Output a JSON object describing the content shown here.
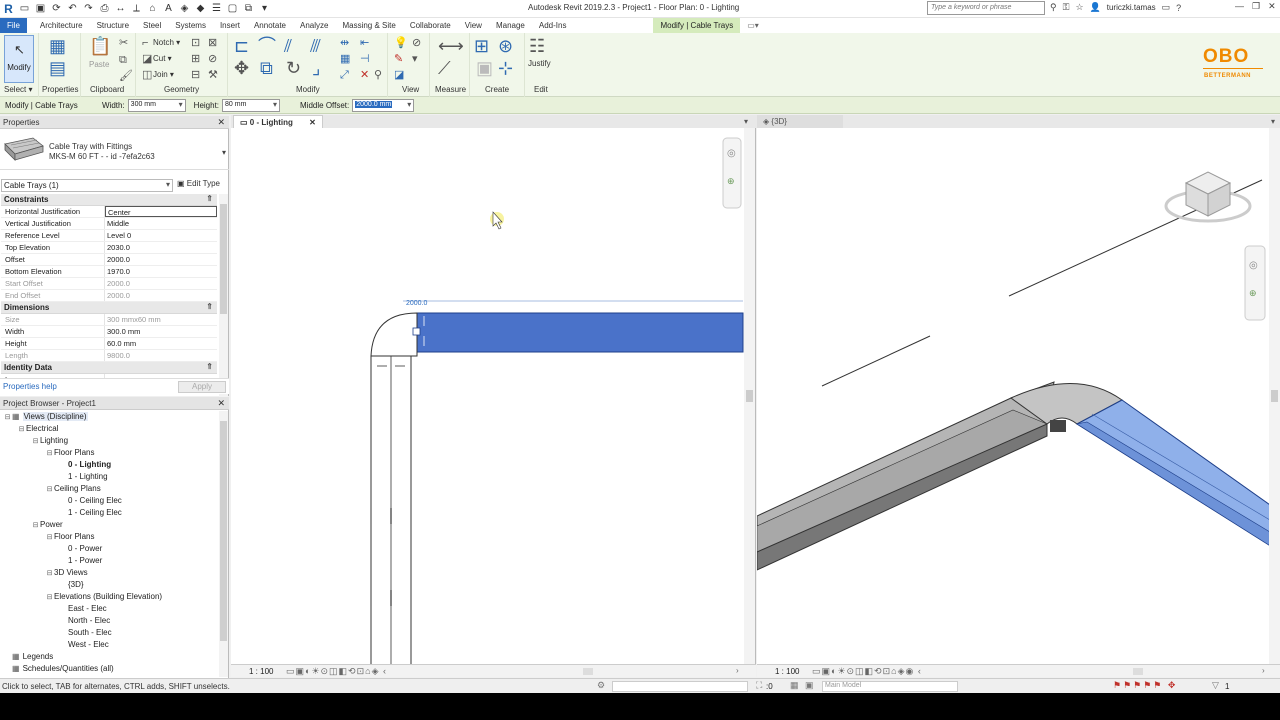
{
  "window": {
    "title": "Autodesk Revit 2019.2.3 - Project1 - Floor Plan: 0 - Lighting",
    "search_placeholder": "Type a keyword or phrase",
    "user": "turiczki.tamas"
  },
  "tabs": [
    "File",
    "Architecture",
    "Structure",
    "Steel",
    "Systems",
    "Insert",
    "Annotate",
    "Analyze",
    "Massing & Site",
    "Collaborate",
    "View",
    "Manage",
    "Add-Ins"
  ],
  "contextual_tab": "Modify | Cable Trays",
  "ribbon": {
    "modify_label": "Modify",
    "properties_label": "Properties",
    "paste_label": "Paste",
    "notch_label": "Notch",
    "cut_label": "Cut",
    "join_label": "Join",
    "justify_label": "Justify",
    "groups": {
      "select": "Select",
      "properties": "Properties",
      "clipboard": "Clipboard",
      "geometry": "Geometry",
      "modify": "Modify",
      "view": "View",
      "measure": "Measure",
      "create": "Create",
      "edit": "Edit"
    },
    "brand_main": "OBO",
    "brand_sub": "BETTERMANN"
  },
  "options_bar": {
    "context": "Modify | Cable Trays",
    "width_label": "Width:",
    "width_value": "300 mm",
    "height_label": "Height:",
    "height_value": "80 mm",
    "offset_label": "Middle Offset:",
    "offset_value": "2000.0 mm"
  },
  "properties": {
    "title": "Properties",
    "type_name": "Cable Tray with Fittings",
    "type_sub": "MKS-M 60 FT - - id -7efa2c63",
    "instance": "Cable Trays (1)",
    "edit_type": "Edit Type",
    "sections": [
      {
        "name": "Constraints",
        "rows": [
          {
            "k": "Horizontal Justification",
            "v": "Center",
            "active": true
          },
          {
            "k": "Vertical Justification",
            "v": "Middle"
          },
          {
            "k": "Reference Level",
            "v": "Level 0"
          },
          {
            "k": "Top Elevation",
            "v": "2030.0"
          },
          {
            "k": "Offset",
            "v": "2000.0"
          },
          {
            "k": "Bottom Elevation",
            "v": "1970.0"
          },
          {
            "k": "Start Offset",
            "v": "2000.0",
            "disabled": true
          },
          {
            "k": "End Offset",
            "v": "2000.0",
            "disabled": true
          }
        ]
      },
      {
        "name": "Dimensions",
        "rows": [
          {
            "k": "Size",
            "v": "300 mmx60 mm",
            "disabled": true
          },
          {
            "k": "Width",
            "v": "300.0 mm"
          },
          {
            "k": "Height",
            "v": "60.0 mm"
          },
          {
            "k": "Length",
            "v": "9800.0",
            "disabled": true
          }
        ]
      },
      {
        "name": "Identity Data",
        "rows": [
          {
            "k": "Image",
            "v": ""
          }
        ]
      }
    ],
    "help_link": "Properties help",
    "apply": "Apply"
  },
  "browser": {
    "title": "Project Browser - Project1",
    "tree": [
      {
        "label": "Views (Discipline)",
        "depth": 0,
        "tog": "⊟",
        "sel": true,
        "icon": true
      },
      {
        "label": "Electrical",
        "depth": 1,
        "tog": "⊟"
      },
      {
        "label": "Lighting",
        "depth": 2,
        "tog": "⊟"
      },
      {
        "label": "Floor Plans",
        "depth": 3,
        "tog": "⊟"
      },
      {
        "label": "0 - Lighting",
        "depth": 4,
        "bold": true
      },
      {
        "label": "1 - Lighting",
        "depth": 4
      },
      {
        "label": "Ceiling Plans",
        "depth": 3,
        "tog": "⊟"
      },
      {
        "label": "0 - Ceiling Elec",
        "depth": 4
      },
      {
        "label": "1 - Ceiling Elec",
        "depth": 4
      },
      {
        "label": "Power",
        "depth": 2,
        "tog": "⊟"
      },
      {
        "label": "Floor Plans",
        "depth": 3,
        "tog": "⊟"
      },
      {
        "label": "0 - Power",
        "depth": 4
      },
      {
        "label": "1 - Power",
        "depth": 4
      },
      {
        "label": "3D Views",
        "depth": 3,
        "tog": "⊟"
      },
      {
        "label": "{3D}",
        "depth": 4
      },
      {
        "label": "Elevations (Building Elevation)",
        "depth": 3,
        "tog": "⊟"
      },
      {
        "label": "East - Elec",
        "depth": 4
      },
      {
        "label": "North - Elec",
        "depth": 4
      },
      {
        "label": "South - Elec",
        "depth": 4
      },
      {
        "label": "West - Elec",
        "depth": 4
      },
      {
        "label": "Legends",
        "depth": 0,
        "icon": true
      },
      {
        "label": "Schedules/Quantities (all)",
        "depth": 0,
        "icon": true
      }
    ]
  },
  "views": {
    "tab1": "0 - Lighting",
    "tab2": "{3D}",
    "dimension": "2000.0",
    "scale1": "1 : 100",
    "scale2": "1 : 100"
  },
  "status": {
    "text": "Click to select, TAB for alternates, CTRL adds, SHIFT unselects.",
    "selection_count": ":0",
    "model": "Main Model",
    "filter_count": "1"
  },
  "colors": {
    "accent": "#2a6bbf",
    "contextual": "#d5ebbc",
    "tray_selected": "#4a72c9",
    "brand": "#f08a00"
  }
}
